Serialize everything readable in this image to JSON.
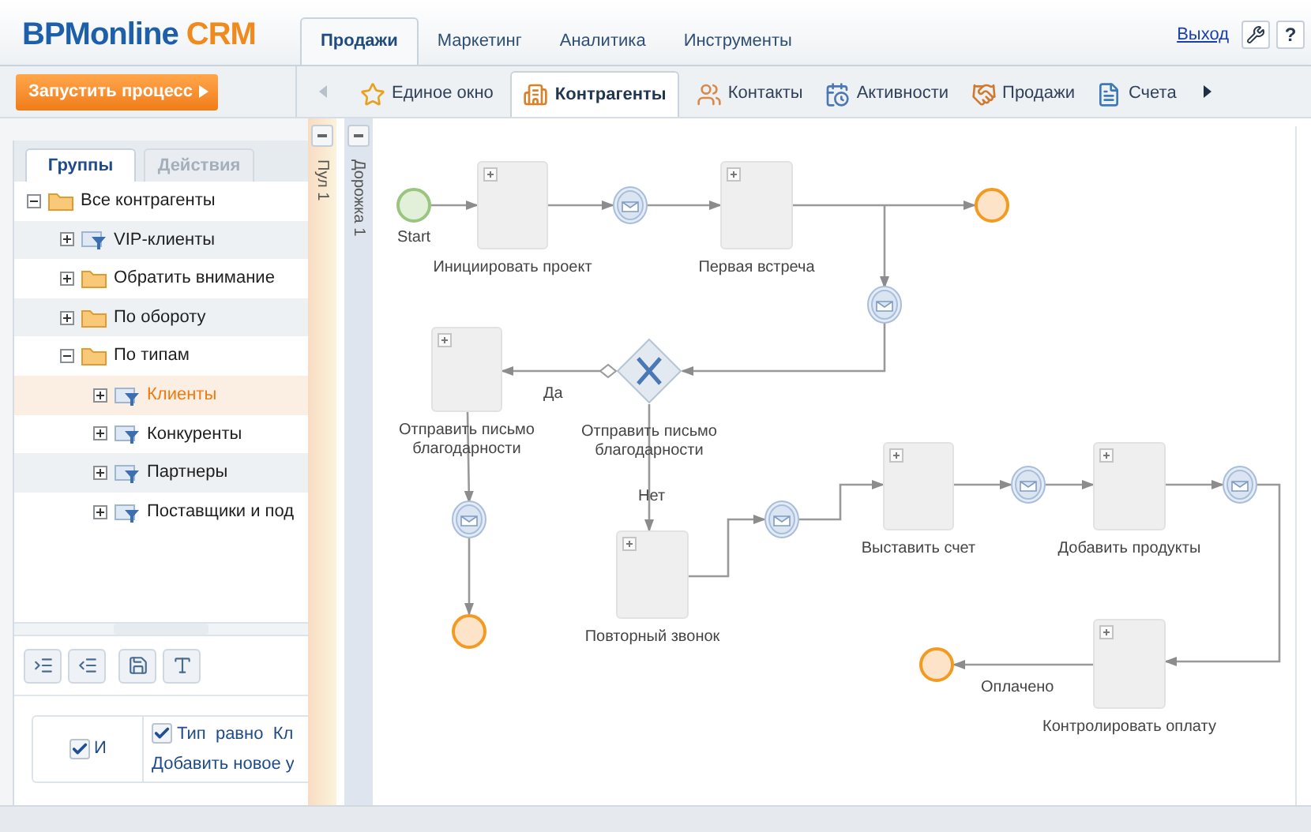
{
  "header": {
    "logo": {
      "main": "BPMonline",
      "accent": " CRM"
    },
    "tabs": [
      {
        "label": "Продажи",
        "selected": true
      },
      {
        "label": "Маркетинг",
        "selected": false
      },
      {
        "label": "Аналитика",
        "selected": false
      },
      {
        "label": "Инструменты",
        "selected": false
      }
    ],
    "logout": "Выход",
    "help": "?"
  },
  "toolbar": {
    "run_button": "Запустить процесс",
    "sections": [
      {
        "label": "Единое окно",
        "kind": "star",
        "selected": false
      },
      {
        "label": "Контрагенты",
        "kind": "building",
        "selected": true
      },
      {
        "label": "Контакты",
        "kind": "people",
        "selected": false
      },
      {
        "label": "Активности",
        "kind": "calendar",
        "selected": false
      },
      {
        "label": "Продажи",
        "kind": "deal",
        "selected": false
      },
      {
        "label": "Счета",
        "kind": "invoice",
        "selected": false
      }
    ]
  },
  "sidebar": {
    "tabs": [
      {
        "label": "Группы",
        "selected": true
      },
      {
        "label": "Действия",
        "selected": false
      }
    ],
    "tree": [
      {
        "label": "Все контрагенты",
        "kind": "folder",
        "expanded": true,
        "selected": false,
        "children": [
          {
            "label": "VIP-клиенты",
            "kind": "filter",
            "expanded": false,
            "selected": false
          },
          {
            "label": "Обратить внимание",
            "kind": "folder",
            "expanded": false,
            "selected": false
          },
          {
            "label": "По обороту",
            "kind": "folder",
            "expanded": false,
            "selected": false
          },
          {
            "label": "По типам",
            "kind": "folder",
            "expanded": true,
            "selected": false,
            "children": [
              {
                "label": "Клиенты",
                "kind": "filter",
                "expanded": false,
                "selected": true
              },
              {
                "label": "Конкуренты",
                "kind": "filter",
                "expanded": false,
                "selected": false
              },
              {
                "label": "Партнеры",
                "kind": "filter",
                "expanded": false,
                "selected": false
              },
              {
                "label": "Поставщики и под",
                "kind": "filter",
                "expanded": false,
                "selected": false
              }
            ]
          }
        ]
      }
    ],
    "filter": {
      "operator": {
        "label": "И",
        "checked": true
      },
      "conditions": [
        {
          "text": "Тип  равно  Кл",
          "checked": true
        }
      ],
      "add_link": "Добавить новое у"
    }
  },
  "pool": {
    "label": "Пул 1",
    "lane": "Дорожка 1"
  },
  "diagram": {
    "nodes": [
      {
        "kind": "start",
        "label": "Start"
      },
      {
        "kind": "task",
        "label": "Инициировать проект"
      },
      {
        "kind": "event"
      },
      {
        "kind": "task",
        "label": "Первая встреча"
      },
      {
        "kind": "end"
      },
      {
        "kind": "event"
      },
      {
        "kind": "task",
        "label": "Отправить письмо благодарности"
      },
      {
        "kind": "gateway",
        "label": "Отправить письмо благодарности"
      },
      {
        "kind": "event"
      },
      {
        "kind": "end"
      },
      {
        "kind": "task",
        "label": "Повторный звонок"
      },
      {
        "kind": "event"
      },
      {
        "kind": "task",
        "label": "Выставить счет"
      },
      {
        "kind": "event"
      },
      {
        "kind": "task",
        "label": "Добавить продукты"
      },
      {
        "kind": "event"
      },
      {
        "kind": "task",
        "label": "Контролировать оплату"
      },
      {
        "kind": "end"
      }
    ],
    "flows": [
      {
        "kind": "sequence"
      },
      {
        "kind": "sequence"
      },
      {
        "kind": "sequence"
      },
      {
        "kind": "sequence"
      },
      {
        "kind": "sequence"
      },
      {
        "kind": "sequence"
      },
      {
        "kind": "default",
        "label": "Да"
      },
      {
        "kind": "sequence"
      },
      {
        "kind": "sequence"
      },
      {
        "kind": "sequence",
        "label": "Нет"
      },
      {
        "kind": "sequence"
      },
      {
        "kind": "sequence"
      },
      {
        "kind": "sequence"
      },
      {
        "kind": "sequence"
      },
      {
        "kind": "sequence"
      },
      {
        "kind": "sequence"
      },
      {
        "kind": "sequence",
        "label": "Оплачено"
      }
    ]
  }
}
